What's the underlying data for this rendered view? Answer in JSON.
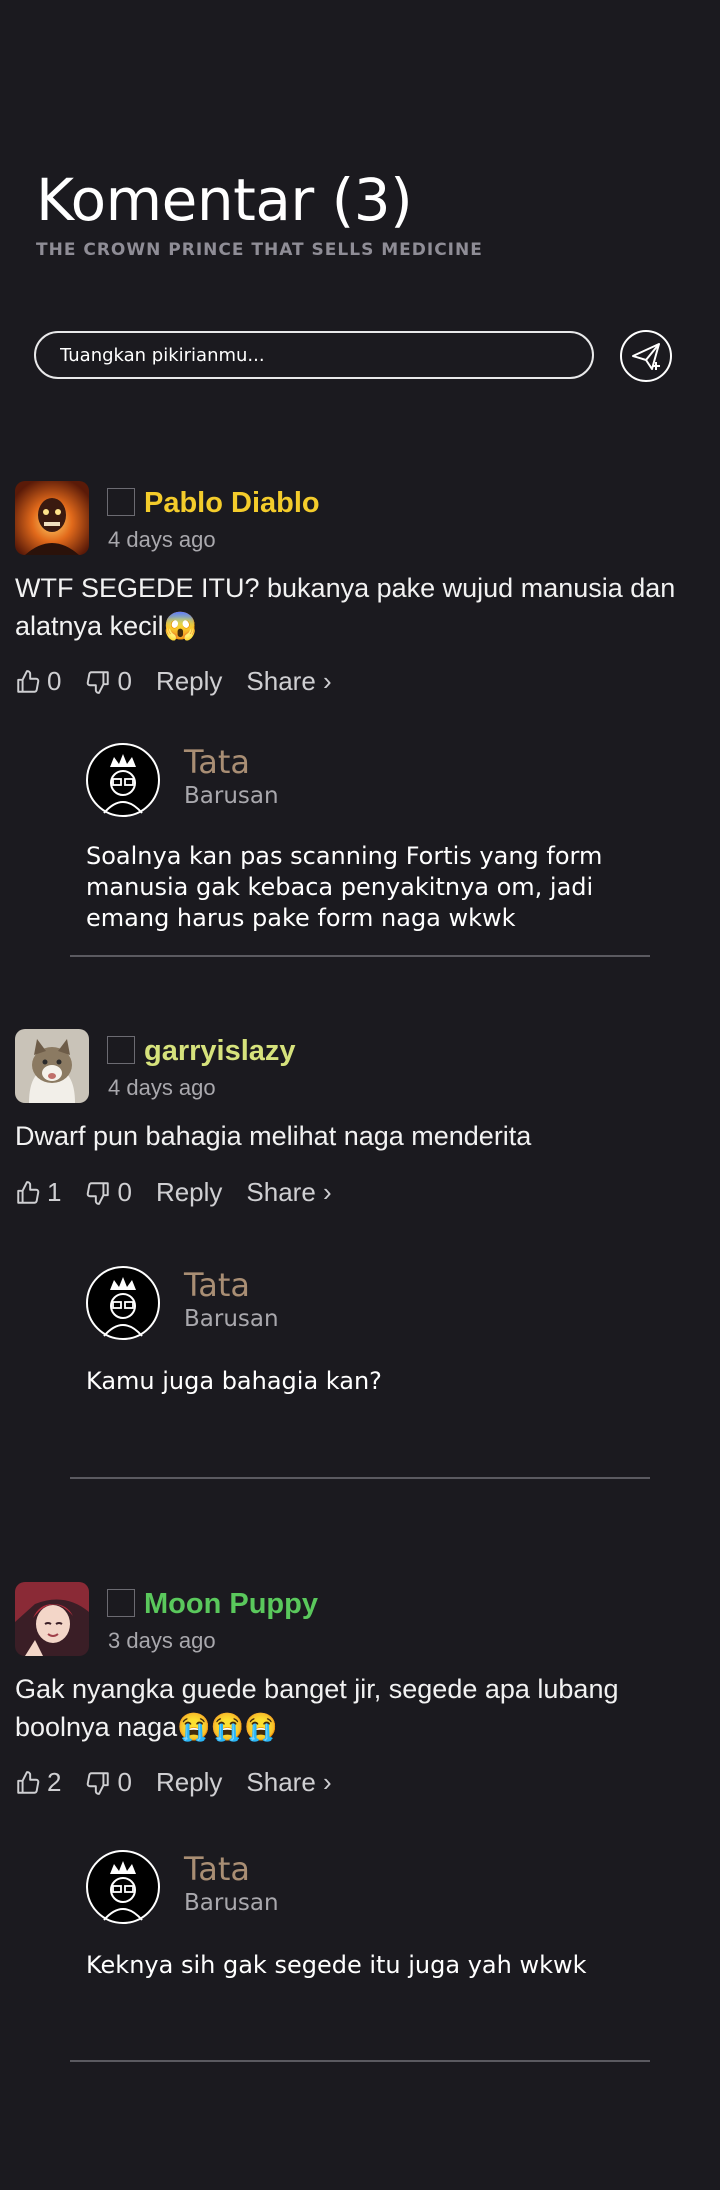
{
  "header": {
    "title": "Komentar (3)",
    "subtitle": "THE CROWN PRINCE THAT SELLS MEDICINE"
  },
  "composer": {
    "placeholder": "Tuangkan pikirianmu...",
    "send_icon": "send-plane-icon"
  },
  "colors": {
    "background": "#1b1a1f",
    "user1": "#f4cc2b",
    "user2": "#d6e27c",
    "user3": "#5ac85c",
    "reply_name": "#a98e74"
  },
  "comments": [
    {
      "username": "Pablo Diablo",
      "time": "4 days ago",
      "text": "WTF SEGEDE ITU? bukanya pake wujud manusia dan alatnya kecil😱",
      "likes": "0",
      "dislikes": "0",
      "reply_label": "Reply",
      "share_label": "Share ›",
      "reply": {
        "name": "Tata",
        "role": "Barusan",
        "text": "Soalnya kan pas scanning Fortis yang form manusia gak kebaca penyakitnya om, jadi emang harus pake form naga wkwk"
      }
    },
    {
      "username": "garryislazy",
      "time": "4 days ago",
      "text": "Dwarf pun bahagia melihat naga menderita",
      "likes": "1",
      "dislikes": "0",
      "reply_label": "Reply",
      "share_label": "Share ›",
      "reply": {
        "name": "Tata",
        "role": "Barusan",
        "text": "Kamu juga bahagia kan?"
      }
    },
    {
      "username": "Moon Puppy",
      "time": "3 days ago",
      "text": "Gak nyangka guede banget jir, segede apa lubang boolnya naga😭😭😭",
      "likes": "2",
      "dislikes": "0",
      "reply_label": "Reply",
      "share_label": "Share ›",
      "reply": {
        "name": "Tata",
        "role": "Barusan",
        "text": "Keknya sih gak segede itu juga yah wkwk"
      }
    }
  ]
}
